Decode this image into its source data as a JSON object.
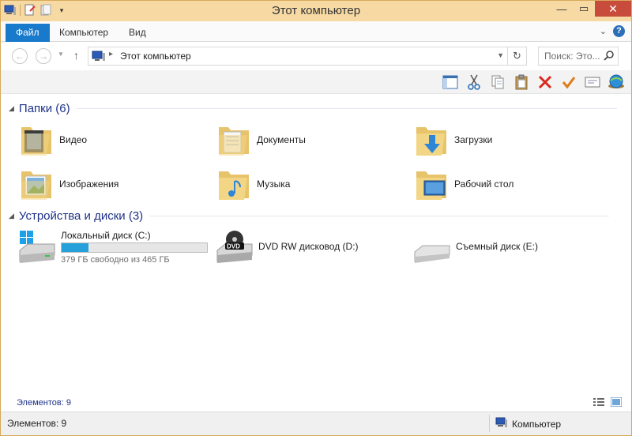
{
  "window": {
    "title": "Этот компьютер"
  },
  "ribbon": {
    "tabs": [
      {
        "label": "Файл"
      },
      {
        "label": "Компьютер"
      },
      {
        "label": "Вид"
      }
    ]
  },
  "address": {
    "path": "Этот компьютер"
  },
  "search": {
    "placeholder": "Поиск: Это..."
  },
  "toolbar": {
    "icons": [
      "layout-pane-icon",
      "cut-icon",
      "copy-icon",
      "paste-icon",
      "delete-icon",
      "checkmark-icon",
      "properties-icon",
      "network-globe-icon"
    ]
  },
  "groups": [
    {
      "title": "Папки (6)",
      "items": [
        {
          "label": "Видео",
          "icon": "video-folder-icon"
        },
        {
          "label": "Документы",
          "icon": "documents-folder-icon"
        },
        {
          "label": "Загрузки",
          "icon": "downloads-folder-icon"
        },
        {
          "label": "Изображения",
          "icon": "pictures-folder-icon"
        },
        {
          "label": "Музыка",
          "icon": "music-folder-icon"
        },
        {
          "label": "Рабочий стол",
          "icon": "desktop-folder-icon"
        }
      ]
    },
    {
      "title": "Устройства и диски (3)",
      "drives": [
        {
          "label": "Локальный диск (C:)",
          "free_text": "379 ГБ свободно из 465 ГБ",
          "used_fraction": 0.185,
          "icon": "system-drive-icon"
        },
        {
          "label": "DVD RW дисковод (D:)",
          "icon": "dvd-drive-icon"
        },
        {
          "label": "Съемный диск (E:)",
          "icon": "removable-drive-icon"
        }
      ]
    }
  ],
  "footer": {
    "count_text": "Элементов: 9"
  },
  "status": {
    "count_text": "Элементов: 9",
    "zone_label": "Компьютер"
  },
  "colors": {
    "accent": "#1979ca",
    "group_title": "#1e3287",
    "window_frame": "#f5d49a",
    "progress": "#26a0da"
  }
}
